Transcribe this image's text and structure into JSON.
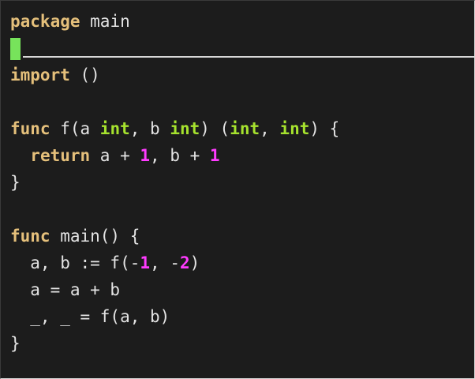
{
  "editor": {
    "lines": [
      [
        {
          "t": "package",
          "c": "kw"
        },
        {
          "t": " main",
          "c": "tx"
        }
      ],
      [
        {
          "cursor": true
        }
      ],
      [
        {
          "t": "import",
          "c": "kw"
        },
        {
          "t": " ()",
          "c": "tx"
        }
      ],
      [],
      [
        {
          "t": "func",
          "c": "kw"
        },
        {
          "t": " f(a ",
          "c": "tx"
        },
        {
          "t": "int",
          "c": "ty"
        },
        {
          "t": ", b ",
          "c": "tx"
        },
        {
          "t": "int",
          "c": "ty"
        },
        {
          "t": ") (",
          "c": "tx"
        },
        {
          "t": "int",
          "c": "ty"
        },
        {
          "t": ", ",
          "c": "tx"
        },
        {
          "t": "int",
          "c": "ty"
        },
        {
          "t": ") {",
          "c": "tx"
        }
      ],
      [
        {
          "t": "  ",
          "c": "tx"
        },
        {
          "t": "return",
          "c": "kw"
        },
        {
          "t": " a + ",
          "c": "tx"
        },
        {
          "t": "1",
          "c": "num"
        },
        {
          "t": ", b + ",
          "c": "tx"
        },
        {
          "t": "1",
          "c": "num"
        }
      ],
      [
        {
          "t": "}",
          "c": "tx"
        }
      ],
      [],
      [
        {
          "t": "func",
          "c": "kw"
        },
        {
          "t": " main() {",
          "c": "tx"
        }
      ],
      [
        {
          "t": "  a, b := f(-",
          "c": "tx"
        },
        {
          "t": "1",
          "c": "num"
        },
        {
          "t": ", -",
          "c": "tx"
        },
        {
          "t": "2",
          "c": "num"
        },
        {
          "t": ")",
          "c": "tx"
        }
      ],
      [
        {
          "t": "  a = a + b",
          "c": "tx"
        }
      ],
      [
        {
          "t": "  _, _ = f(a, b)",
          "c": "tx"
        }
      ],
      [
        {
          "t": "}",
          "c": "tx"
        }
      ]
    ]
  },
  "colors": {
    "background": "#1c1c1c",
    "keyword": "#e5c07b",
    "type": "#a6e22e",
    "number": "#ff3bff",
    "text": "#e4e4e4",
    "cursor": "#77e35b"
  }
}
